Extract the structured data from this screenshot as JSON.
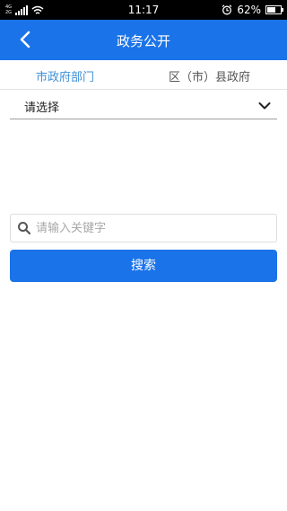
{
  "status_bar": {
    "network_top": "4G",
    "network_bottom": "2G",
    "time": "11:17",
    "battery": "62%",
    "battery_level": 0.62,
    "icons": [
      "signal-icon",
      "wifi-icon",
      "alarm-icon",
      "battery-icon"
    ]
  },
  "header": {
    "title": "政务公开",
    "back_icon": "chevron-left-icon",
    "color": "#1a73e8"
  },
  "tabs": [
    {
      "label": "市政府部门",
      "active": true,
      "color": "#3d8fd6"
    },
    {
      "label": "区（市）县政府",
      "active": false,
      "color": "#555555"
    }
  ],
  "select": {
    "value": "请选择",
    "icon": "chevron-down-icon"
  },
  "search": {
    "placeholder": "请输入关键字",
    "icon": "search-icon",
    "button_label": "搜索",
    "button_color": "#1a73e8"
  }
}
